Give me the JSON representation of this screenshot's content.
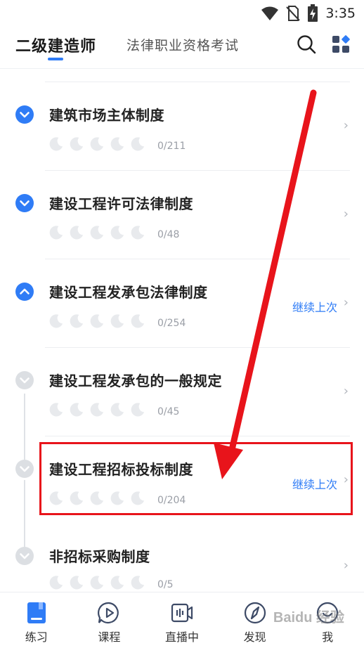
{
  "status_bar": {
    "time": "3:35",
    "icons": [
      "wifi-icon",
      "no-sim-icon",
      "battery-charging-icon"
    ]
  },
  "header": {
    "active_tab": "二级建造师",
    "inactive_tab": "法律职业资格考试",
    "icons": [
      "search-icon",
      "apps-grid-icon"
    ],
    "accent_color": "#2f7cf6"
  },
  "chapters": [
    {
      "title": "建筑市场主体制度",
      "progress": "0/211",
      "continue": "",
      "state": "collapsed-blue"
    },
    {
      "title": "建设工程许可法律制度",
      "progress": "0/48",
      "continue": "",
      "state": "collapsed-blue"
    },
    {
      "title": "建设工程发承包法律制度",
      "progress": "0/254",
      "continue": "继续上次",
      "state": "expanded-blue"
    },
    {
      "title": "建设工程发承包的一般规定",
      "progress": "0/45",
      "continue": "",
      "state": "sub-gray"
    },
    {
      "title": "建设工程招标投标制度",
      "progress": "0/204",
      "continue": "继续上次",
      "state": "sub-gray"
    },
    {
      "title": "非招标采购制度",
      "progress": "0/5",
      "continue": "",
      "state": "sub-gray"
    }
  ],
  "bottom_nav": [
    {
      "label": "练习",
      "icon": "book-icon",
      "active": true
    },
    {
      "label": "课程",
      "icon": "play-bubble-icon",
      "active": false
    },
    {
      "label": "直播中",
      "icon": "live-video-icon",
      "active": false
    },
    {
      "label": "发现",
      "icon": "compass-icon",
      "active": false
    },
    {
      "label": "我",
      "icon": "smile-icon",
      "active": false
    }
  ],
  "watermark": "Baidu 经验",
  "annotation_color": "#e8141b"
}
